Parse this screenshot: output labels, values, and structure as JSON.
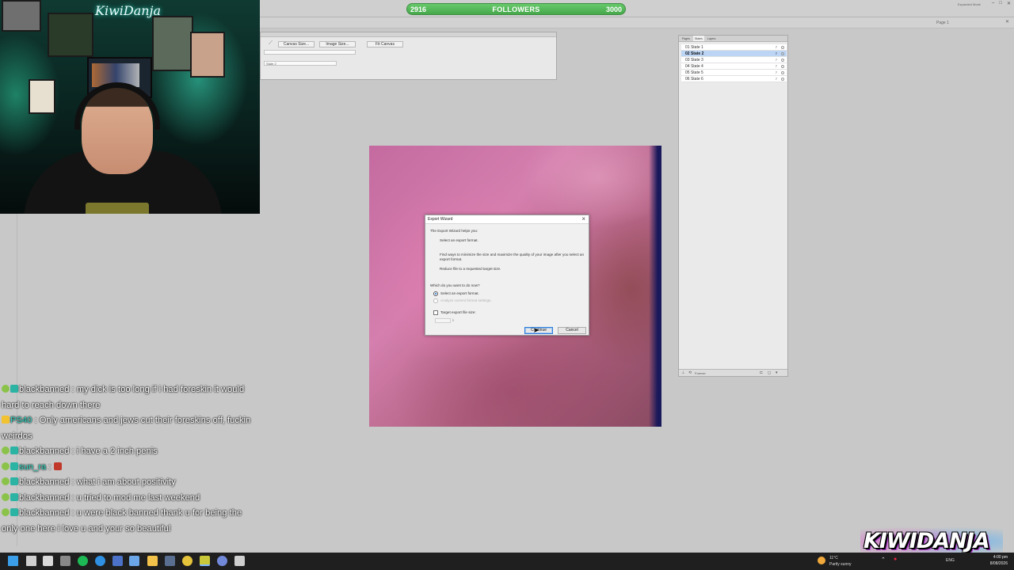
{
  "followers": {
    "current": "2916",
    "label": "FOLLOWERS",
    "goal": "3000",
    "progress": 0
  },
  "app": {
    "mode_label": "Expanded Mode",
    "page_label": "Page 1",
    "properties": {
      "canvas_size": "Canvas Size...",
      "image_size": "Image Size...",
      "fit_canvas": "Fit Canvas",
      "state_value": "State 2"
    },
    "states_panel": {
      "tabs": [
        "Pages",
        "States",
        "Layers"
      ],
      "states": [
        {
          "label": "01 State 1",
          "delay": "7"
        },
        {
          "label": "02 State 2",
          "delay": "7"
        },
        {
          "label": "03 State 3",
          "delay": "7"
        },
        {
          "label": "04 State 4",
          "delay": "7"
        },
        {
          "label": "05 State 5",
          "delay": "7"
        },
        {
          "label": "06 State 6",
          "delay": "7"
        }
      ],
      "selected_index": 1,
      "loop_value": "Forever"
    }
  },
  "dialog": {
    "title": "Export Wizard",
    "intro": "The Export Wizard helps you:",
    "bullet_1": "Select an export format.",
    "bullet_2": "Find ways to minimize the size and maximize the quality of your image after you select an export format.",
    "bullet_3": "Reduce file to a requested target size.",
    "question": "Which do you want to do now?",
    "option_1": "Select an export format.",
    "option_2": "Analyze current format settings.",
    "checkbox_label": "Target export file size:",
    "size_value": "",
    "size_unit": "k",
    "continue_label": "Continue",
    "cancel_label": "Cancel"
  },
  "webcam": {
    "neon_text": "KiwiDanja"
  },
  "chat": [
    {
      "badges": [
        "user",
        "sub"
      ],
      "name": "blackbanned",
      "name_color": "#ffffff",
      "text": " : my dick is too long if i had foreskin it would hard to reach down there"
    },
    {
      "badges": [
        "bolt"
      ],
      "name": "PS40",
      "name_color": "#2fd7c2",
      "text": " : Only americans and jews cut their foreskins off, fuckin weirdos"
    },
    {
      "badges": [
        "user",
        "sub"
      ],
      "name": "blackbanned",
      "name_color": "#ffffff",
      "text": " : i have a 2 inch penis"
    },
    {
      "badges": [
        "user",
        "sub"
      ],
      "name": "sun_ra",
      "name_color": "#2fd7c2",
      "text": " : ",
      "emote": "rose"
    },
    {
      "badges": [
        "user",
        "sub"
      ],
      "name": "blackbanned",
      "name_color": "#ffffff",
      "text": " : what i am about positivity"
    },
    {
      "badges": [
        "user",
        "sub"
      ],
      "name": "blackbanned",
      "name_color": "#ffffff",
      "text": " : u tried to mod me last weekend"
    },
    {
      "badges": [
        "user",
        "sub"
      ],
      "name": "blackbanned",
      "name_color": "#ffffff",
      "text": " : u were black banned thank u for being the only one here i love u and your so beautiful"
    }
  ],
  "logo": {
    "text": "KIWIDANJA"
  },
  "taskbar": {
    "weather_temp": "11°C",
    "weather_desc": "Partly sunny",
    "time": "4:00 pm",
    "date": "8/08/2026",
    "lang": "ENG",
    "icons": [
      {
        "name": "windows-start-icon",
        "color": "#3a9ee8"
      },
      {
        "name": "search-icon",
        "color": "#cfcfcf"
      },
      {
        "name": "shield-icon",
        "color": "#d9d9d9"
      },
      {
        "name": "obs-icon",
        "color": "#888888"
      },
      {
        "name": "spotify-icon",
        "color": "#1db954"
      },
      {
        "name": "edge-icon",
        "color": "#2f8fe0"
      },
      {
        "name": "app-icon",
        "color": "#4b72c8"
      },
      {
        "name": "task-view-icon",
        "color": "#6ba6e8"
      },
      {
        "name": "file-explorer-icon",
        "color": "#f3c24a"
      },
      {
        "name": "steam-icon",
        "color": "#5a6f8f"
      },
      {
        "name": "chrome-icon",
        "color": "#e5c33a"
      },
      {
        "name": "fireworks-icon",
        "color": "#c8c83a"
      },
      {
        "name": "discord-icon",
        "color": "#7289da"
      },
      {
        "name": "cloud-icon",
        "color": "#cfcfcf"
      }
    ]
  }
}
